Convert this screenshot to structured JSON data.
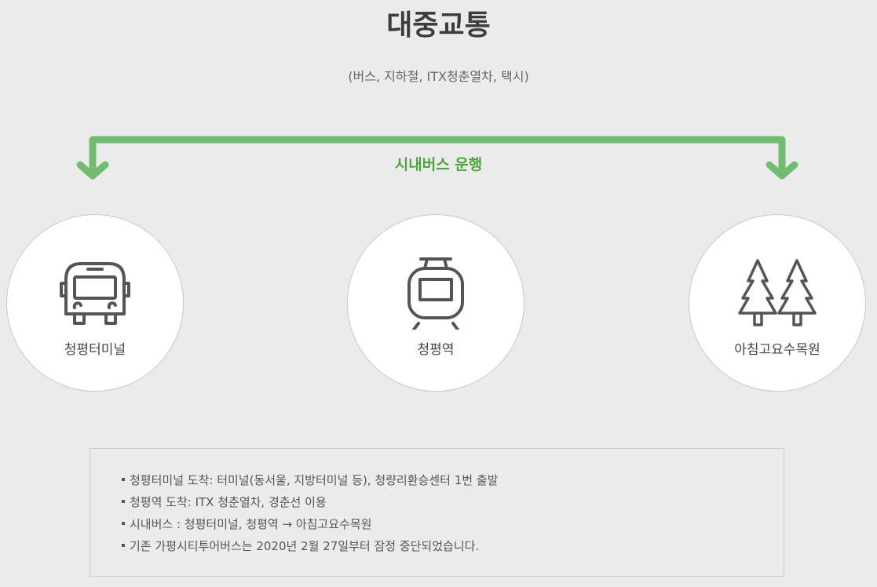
{
  "header": {
    "title": "대중교통",
    "subtitle": "(버스, 지하철, ITX청춘열차, 택시)"
  },
  "route": {
    "label": "시내버스 운행",
    "color": "#72bc72",
    "label_color": "#4ea43d"
  },
  "stops": [
    {
      "icon": "bus-icon",
      "label": "청평터미널"
    },
    {
      "icon": "train-icon",
      "label": "청평역"
    },
    {
      "icon": "trees-icon",
      "label": "아침고요수목원"
    }
  ],
  "notes": [
    "청평터미널 도착: 터미널(동서울, 지방터미널 등), 청량리환승센터 1번 출발",
    "청평역 도착: ITX 청춘열차, 경춘선 이용",
    "시내버스 : 청평터미널, 청평역 → 아침고요수목원",
    "기존 가평시티투어버스는 2020년 2월 27일부터 잠정 중단되었습니다."
  ]
}
